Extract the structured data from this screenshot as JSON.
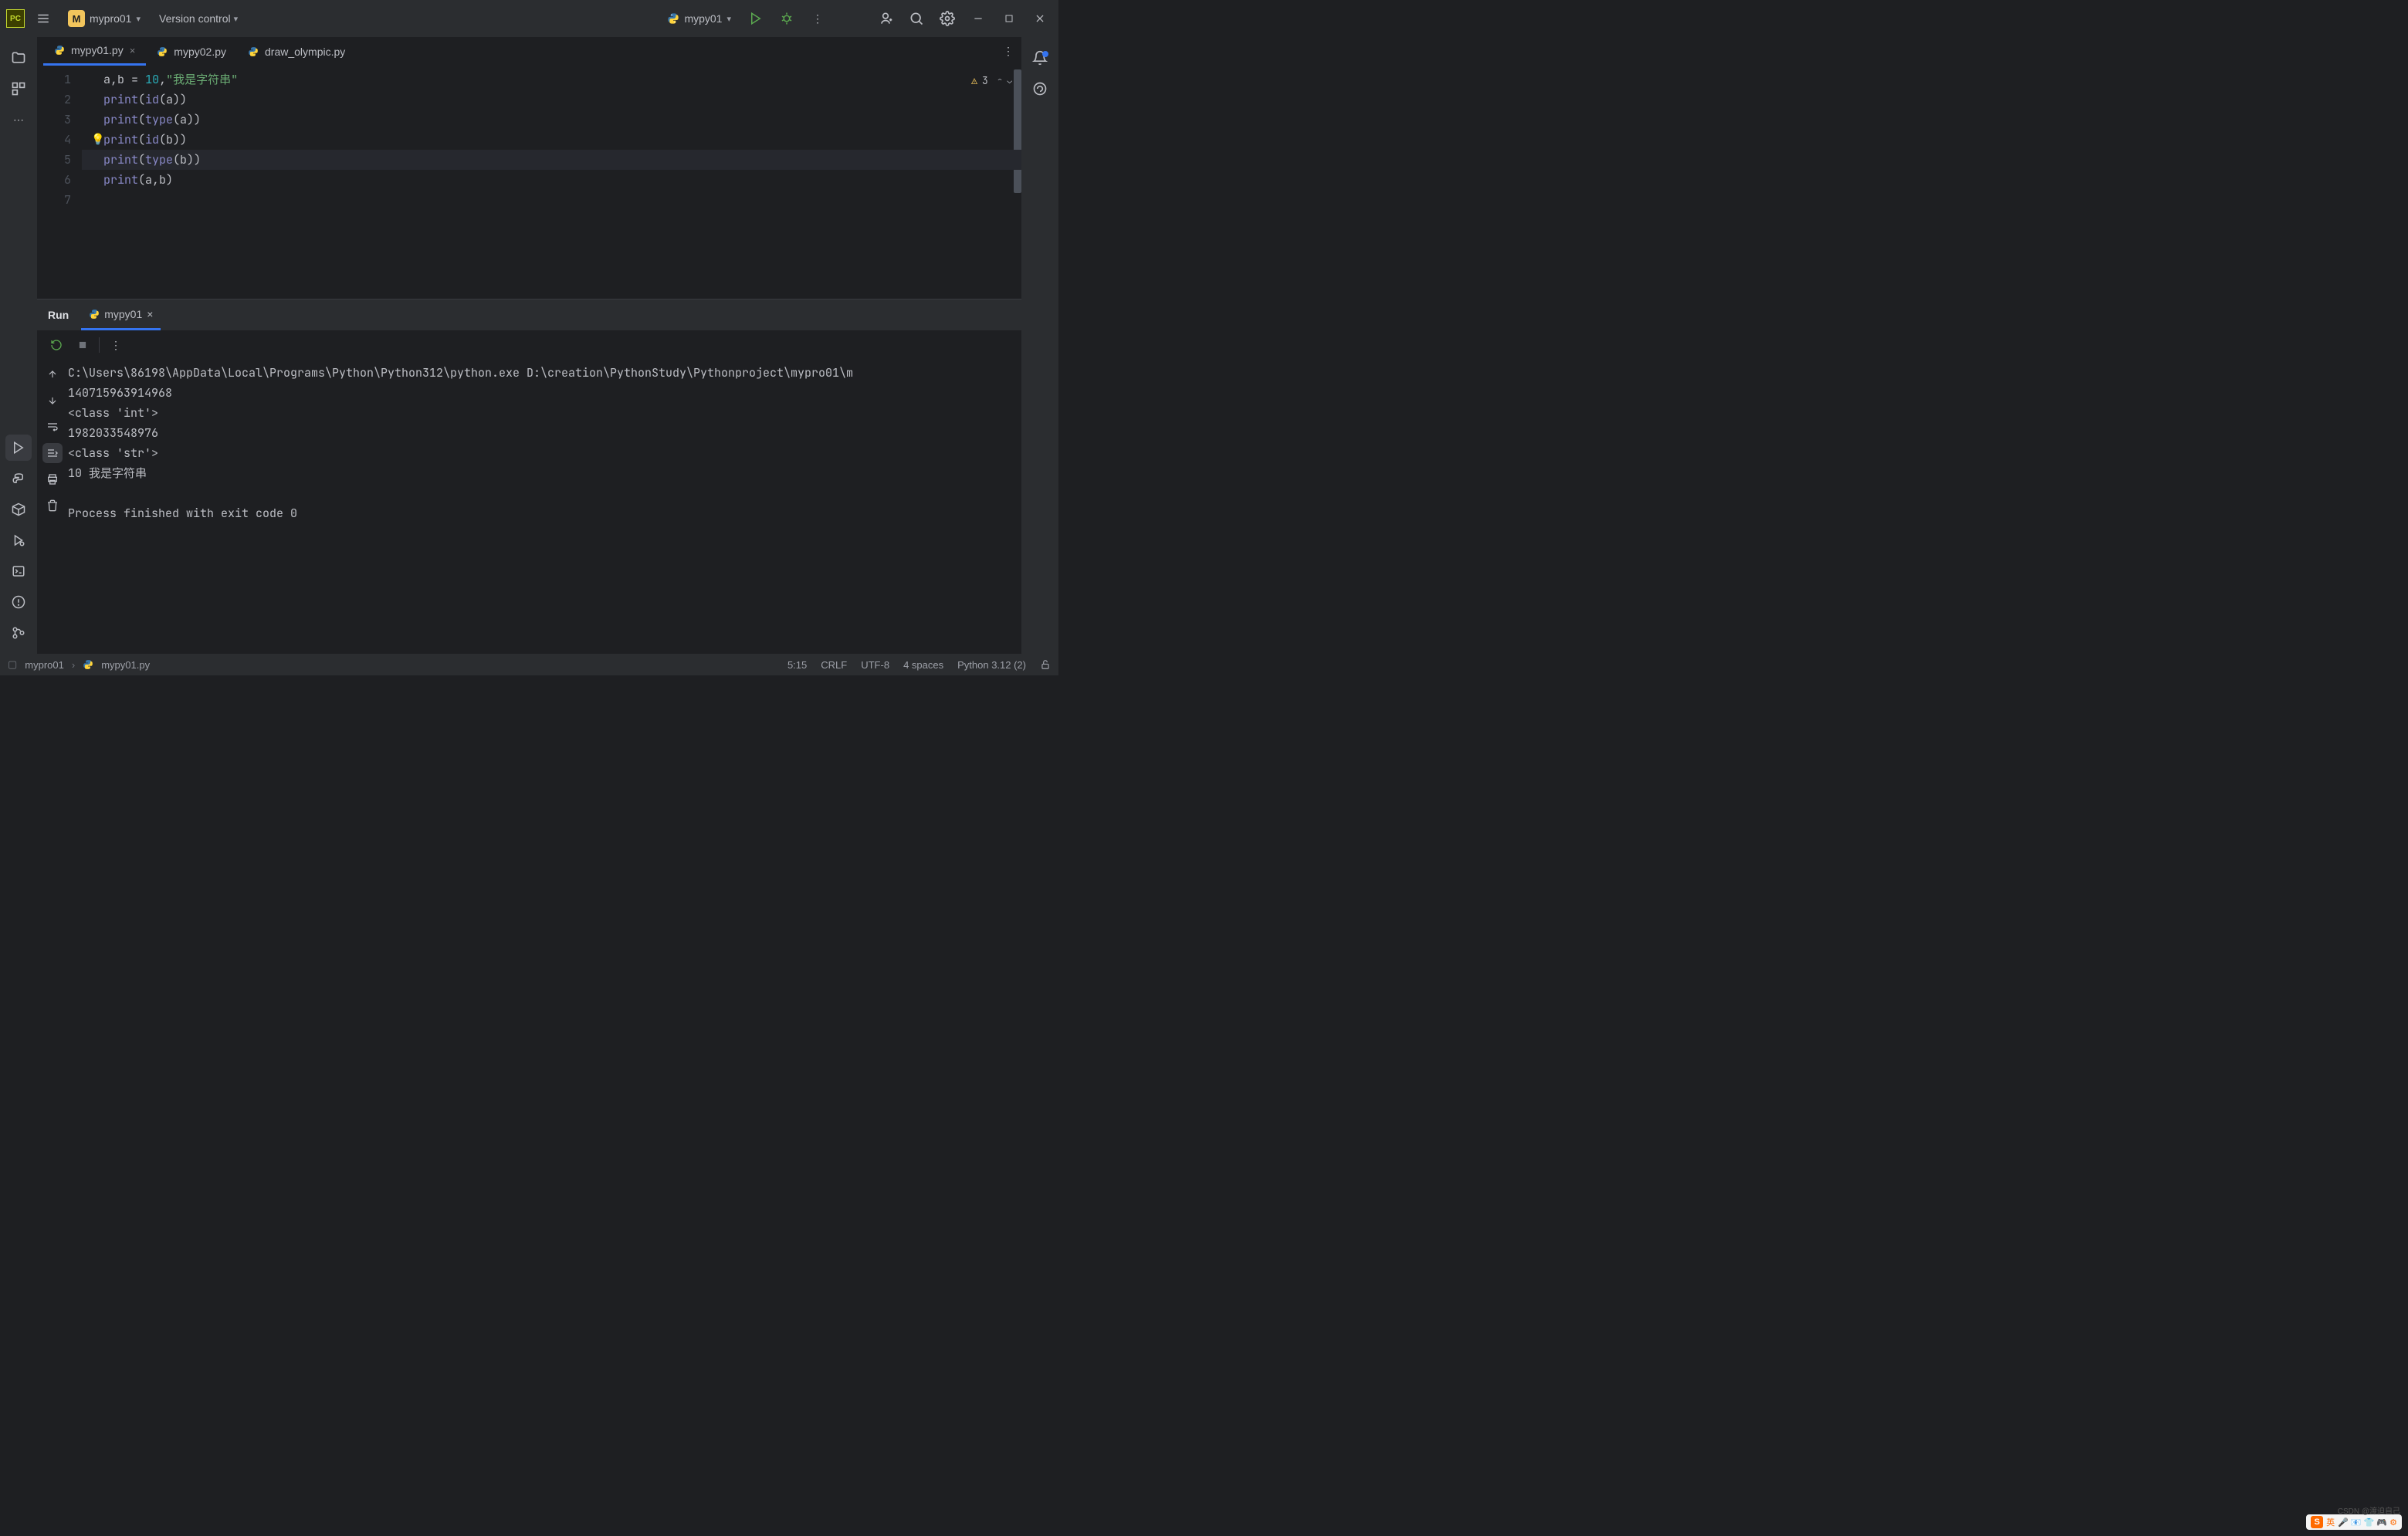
{
  "titlebar": {
    "project_name": "mypro01",
    "project_initial": "M",
    "version_control": "Version control",
    "run_config": "mypy01"
  },
  "editor_tabs": [
    {
      "label": "mypy01.py",
      "active": true,
      "closeable": true
    },
    {
      "label": "mypy02.py",
      "active": false,
      "closeable": false
    },
    {
      "label": "draw_olympic.py",
      "active": false,
      "closeable": false
    }
  ],
  "code": {
    "lines": [
      {
        "n": "1",
        "tokens": [
          {
            "t": "a",
            "c": "ident"
          },
          {
            "t": ",",
            "c": "op"
          },
          {
            "t": "b ",
            "c": "ident"
          },
          {
            "t": "= ",
            "c": "op"
          },
          {
            "t": "10",
            "c": "num"
          },
          {
            "t": ",",
            "c": "op"
          },
          {
            "t": "\"我是字符串\"",
            "c": "str"
          }
        ]
      },
      {
        "n": "2",
        "tokens": [
          {
            "t": "print",
            "c": "builtin"
          },
          {
            "t": "(",
            "c": "op"
          },
          {
            "t": "id",
            "c": "builtin"
          },
          {
            "t": "(a))",
            "c": "op"
          }
        ]
      },
      {
        "n": "3",
        "tokens": [
          {
            "t": "print",
            "c": "builtin"
          },
          {
            "t": "(",
            "c": "op"
          },
          {
            "t": "type",
            "c": "builtin"
          },
          {
            "t": "(a))",
            "c": "op"
          }
        ]
      },
      {
        "n": "4",
        "tokens": [
          {
            "t": "print",
            "c": "builtin"
          },
          {
            "t": "(",
            "c": "op"
          },
          {
            "t": "id",
            "c": "builtin"
          },
          {
            "t": "(b))",
            "c": "op"
          }
        ]
      },
      {
        "n": "5",
        "hl": true,
        "tokens": [
          {
            "t": "print",
            "c": "builtin"
          },
          {
            "t": "(",
            "c": "op"
          },
          {
            "t": "type",
            "c": "builtin"
          },
          {
            "t": "(b)",
            "c": "op"
          },
          {
            "t": ")",
            "c": "op hl-paren"
          }
        ]
      },
      {
        "n": "6",
        "tokens": [
          {
            "t": "print",
            "c": "builtin"
          },
          {
            "t": "(a",
            "c": "op"
          },
          {
            "t": ",",
            "c": "op"
          },
          {
            "t": "b)",
            "c": "op"
          }
        ]
      },
      {
        "n": "7",
        "tokens": []
      }
    ],
    "warning_count": "3"
  },
  "run": {
    "title": "Run",
    "tab_label": "mypy01",
    "output": [
      "C:\\Users\\86198\\AppData\\Local\\Programs\\Python\\Python312\\python.exe D:\\creation\\PythonStudy\\Pythonproject\\mypro01\\m",
      "140715963914968",
      "<class 'int'>",
      "1982033548976",
      "<class 'str'>",
      "10 我是字符串",
      "",
      "Process finished with exit code 0"
    ]
  },
  "statusbar": {
    "breadcrumb_root": "mypro01",
    "breadcrumb_file": "mypy01.py",
    "position": "5:15",
    "line_sep": "CRLF",
    "encoding": "UTF-8",
    "indent": "4 spaces",
    "interpreter": "Python 3.12 (2)"
  },
  "ime": {
    "label": "英"
  },
  "watermark": "CSDN @渡迫自己"
}
